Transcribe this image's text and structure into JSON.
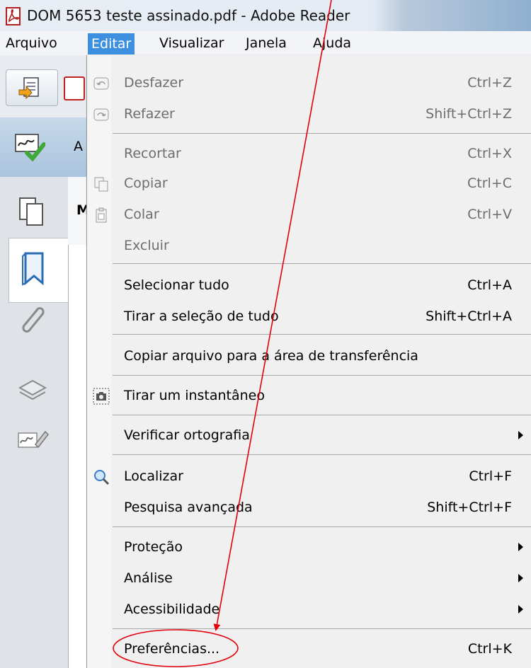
{
  "window": {
    "title": "DOM 5653 teste assinado.pdf - Adobe Reader",
    "app_icon": "adobe-pdf-icon"
  },
  "menubar": {
    "items": [
      "Arquivo",
      "Editar",
      "Visualizar",
      "Janela",
      "Ajuda"
    ],
    "active": "Editar"
  },
  "background": {
    "toolbar_letter": "A",
    "panel_letter": "M"
  },
  "edit_menu": {
    "items": [
      {
        "label": "Desfazer",
        "shortcut": "Ctrl+Z",
        "enabled": false,
        "icon": "undo-icon"
      },
      {
        "label": "Refazer",
        "shortcut": "Shift+Ctrl+Z",
        "enabled": false,
        "icon": "redo-icon"
      },
      {
        "label": "Recortar",
        "shortcut": "Ctrl+X",
        "enabled": false
      },
      {
        "label": "Copiar",
        "shortcut": "Ctrl+C",
        "enabled": false,
        "icon": "copy-icon"
      },
      {
        "label": "Colar",
        "shortcut": "Ctrl+V",
        "enabled": false,
        "icon": "paste-icon"
      },
      {
        "label": "Excluir",
        "shortcut": "",
        "enabled": false
      },
      {
        "label": "Selecionar tudo",
        "shortcut": "Ctrl+A",
        "enabled": true
      },
      {
        "label": "Tirar a seleção de tudo",
        "shortcut": "Shift+Ctrl+A",
        "enabled": true
      },
      {
        "label": "Copiar arquivo para a área de transferência",
        "shortcut": "",
        "enabled": true
      },
      {
        "label": "Tirar um instantâneo",
        "shortcut": "",
        "enabled": true,
        "icon": "camera-icon"
      },
      {
        "label": "Verificar ortografia",
        "shortcut": "",
        "enabled": true,
        "submenu": true
      },
      {
        "label": "Localizar",
        "shortcut": "Ctrl+F",
        "enabled": true,
        "icon": "magnifier-icon"
      },
      {
        "label": "Pesquisa avançada",
        "shortcut": "Shift+Ctrl+F",
        "enabled": true
      },
      {
        "label": "Proteção",
        "shortcut": "",
        "enabled": true,
        "submenu": true
      },
      {
        "label": "Análise",
        "shortcut": "",
        "enabled": true,
        "submenu": true
      },
      {
        "label": "Acessibilidade",
        "shortcut": "",
        "enabled": true,
        "submenu": true
      },
      {
        "label": "Preferências...",
        "shortcut": "Ctrl+K",
        "enabled": true,
        "highlighted_by_annotation": true
      }
    ]
  },
  "annotation": {
    "color": "#e3000b",
    "type": "arrow-and-circle",
    "target": "Preferências..."
  }
}
